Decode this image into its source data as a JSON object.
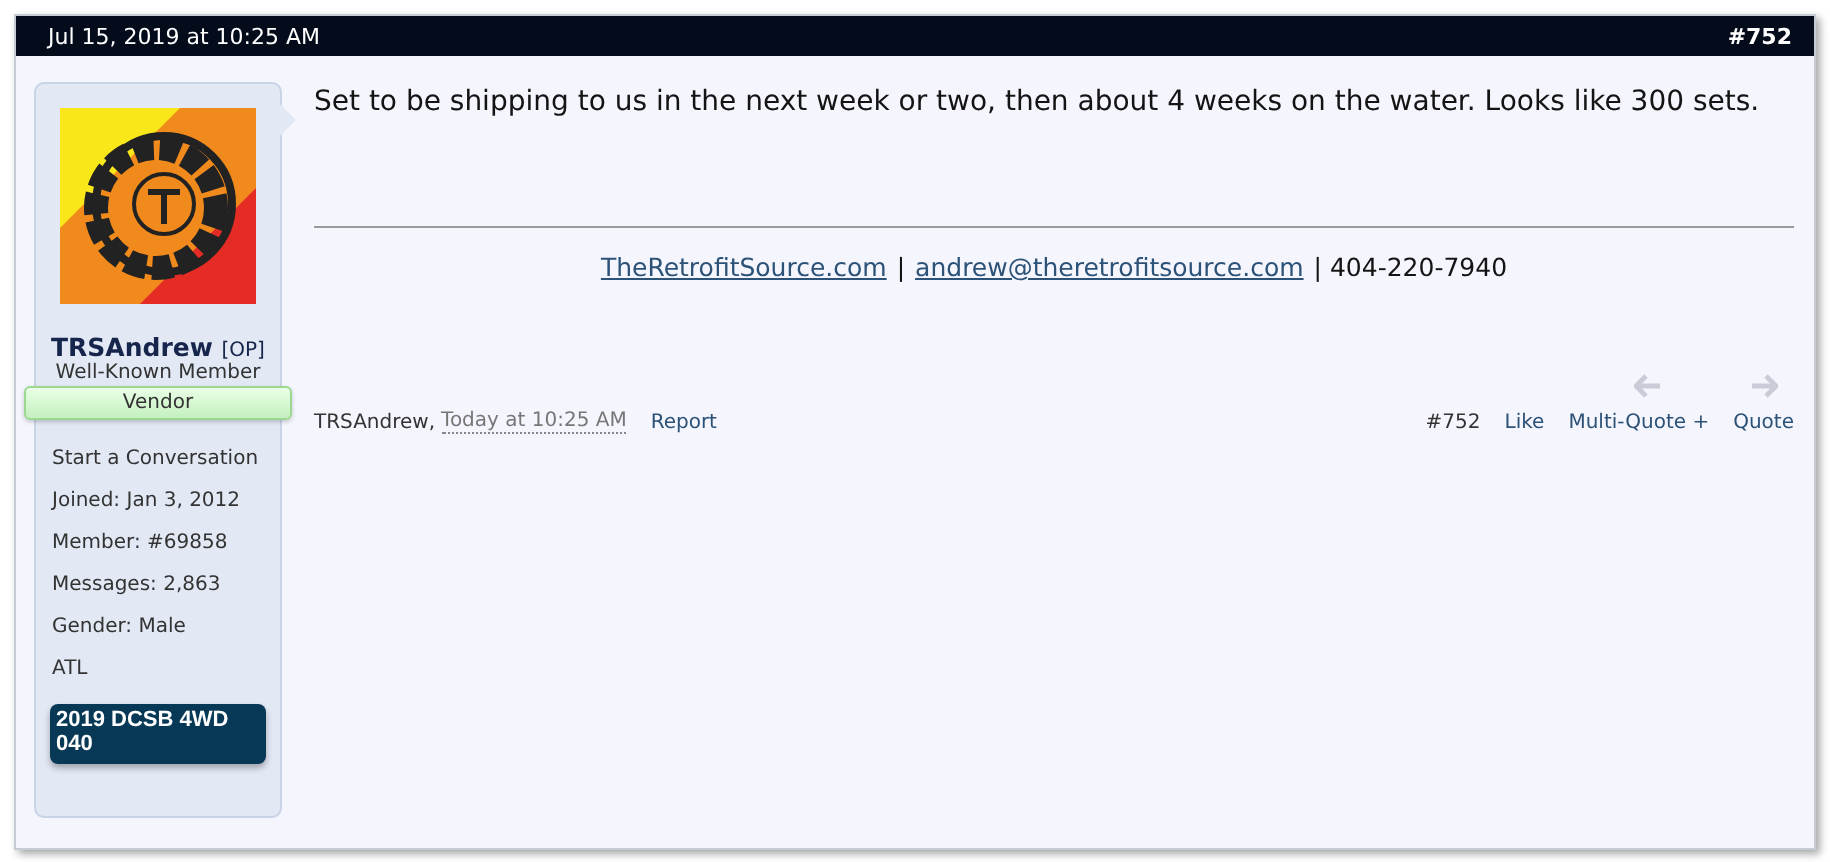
{
  "header": {
    "date": "Jul 15, 2019 at 10:25 AM",
    "number": "#752"
  },
  "user": {
    "name": "TRSAndrew",
    "badge": "[OP]",
    "title": "Well-Known Member",
    "banner": "Vendor",
    "stats": [
      {
        "kind": "link",
        "text": "Start a Conversation"
      },
      {
        "kind": "pair",
        "label": "Joined:",
        "value": "Jan 3, 2012"
      },
      {
        "kind": "pair",
        "label": "Member:",
        "value": "#69858"
      },
      {
        "kind": "pair",
        "label": "Messages:",
        "value": "2,863"
      },
      {
        "kind": "pair",
        "label": "Gender:",
        "value": "Male"
      },
      {
        "kind": "text",
        "text": "ATL"
      }
    ],
    "vehicle": "2019 DCSB 4WD 040"
  },
  "message": "Set to be shipping to us in the next week or two, then about 4 weeks on the water. Looks like 300 sets.",
  "signature": [
    {
      "kind": "link",
      "text": "TheRetrofitSource.com"
    },
    {
      "kind": "text",
      "text": "|"
    },
    {
      "kind": "link",
      "text": "andrew@theretrofitsource.com"
    },
    {
      "kind": "text",
      "text": "| 404-220-7940"
    }
  ],
  "footer": {
    "author": "TRSAndrew,",
    "time": "Today at 10:25 AM",
    "report": "Report",
    "number": "#752",
    "actions": [
      "Like",
      "Multi-Quote +",
      "Quote"
    ],
    "nav": [
      {
        "kind": "previous",
        "disabled": true
      },
      {
        "kind": "next",
        "disabled": true
      }
    ]
  }
}
